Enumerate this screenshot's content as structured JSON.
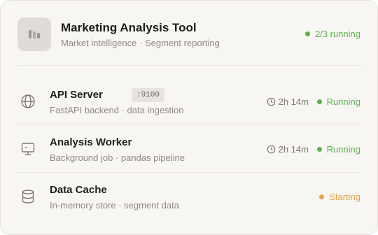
{
  "app": {
    "title": "Marketing Analysis Tool",
    "subtitle": "Market intelligence · Segment reporting",
    "status": "2/3 running",
    "icon": "bar-chart-icon"
  },
  "services": [
    {
      "name": "API Server",
      "port": ":9100",
      "description": "FastAPI backend · data ingestion",
      "uptime": "2h 14m",
      "status": "Running",
      "icon": "globe-icon"
    },
    {
      "name": "Analysis Worker",
      "description": "Background job · pandas pipeline",
      "uptime": "2h 14m",
      "status": "Running",
      "icon": "monitor-icon"
    },
    {
      "name": "Data Cache",
      "description": "In-memory store · segment data",
      "status": "Starting",
      "icon": "database-icon"
    }
  ],
  "colors": {
    "running": "#5cb04e",
    "starting": "#e3a446",
    "card_bg": "#f8f6f3"
  }
}
